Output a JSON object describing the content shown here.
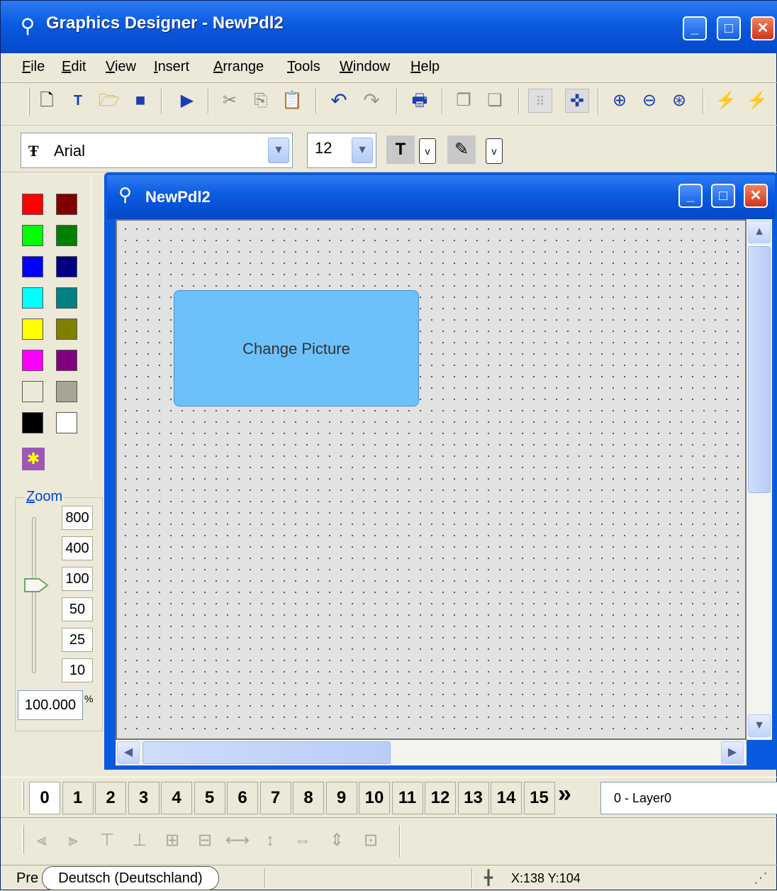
{
  "app": {
    "title": "Graphics Designer - NewPdl2"
  },
  "menu": [
    "File",
    "Edit",
    "View",
    "Insert",
    "Arrange",
    "Tools",
    "Window",
    "Help"
  ],
  "menu_access": [
    "F",
    "E",
    "V",
    "I",
    "A",
    "T",
    "W",
    "H"
  ],
  "toolbar": {
    "icons": [
      "new-file-icon",
      "new-template-icon",
      "open-folder-icon",
      "save-icon",
      "run-icon",
      "cut-icon",
      "copy-icon",
      "paste-icon",
      "undo-icon",
      "redo-icon",
      "print-icon",
      "bring-front-icon",
      "send-back-icon",
      "grid-icon",
      "snap-icon",
      "zoom-in-icon",
      "zoom-out-icon",
      "zoom-fit-icon",
      "wand-icon",
      "wand2-icon"
    ]
  },
  "format": {
    "font": "Arial",
    "size": "12"
  },
  "palette": {
    "colors": [
      "#ff0000",
      "#800000",
      "#00ff00",
      "#008000",
      "#0000ff",
      "#000080",
      "#00ffff",
      "#008080",
      "#ffff00",
      "#808000",
      "#ff00ff",
      "#800080",
      "#ece9d8",
      "#a8a594",
      "#000000",
      "#ffffff"
    ]
  },
  "zoom": {
    "label": "Zoom",
    "presets": [
      "800",
      "400",
      "100",
      "50",
      "25",
      "10"
    ],
    "value": "100.000",
    "unit": "%"
  },
  "child": {
    "title": "NewPdl2"
  },
  "canvas": {
    "button_text": "Change Picture"
  },
  "layers": {
    "buttons": [
      "0",
      "1",
      "2",
      "3",
      "4",
      "5",
      "6",
      "7",
      "8",
      "9",
      "10",
      "11",
      "12",
      "13",
      "14",
      "15"
    ],
    "more": "»",
    "active_layer": "0 - Layer0"
  },
  "status": {
    "pre": "Pre",
    "language": "Deutsch (Deutschland)",
    "coords": "X:138 Y:104"
  }
}
